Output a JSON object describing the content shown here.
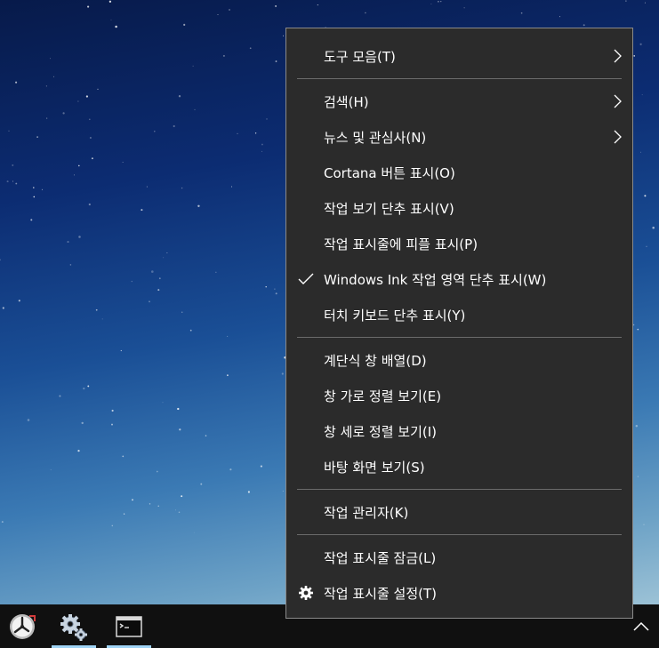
{
  "menu": {
    "items": [
      {
        "label": "도구 모음(T)",
        "submenu": true
      },
      {
        "label": "검색(H)",
        "submenu": true
      },
      {
        "label": "뉴스 및 관심사(N)",
        "submenu": true
      },
      {
        "label": "Cortana 버튼 표시(O)"
      },
      {
        "label": "작업 보기 단추 표시(V)"
      },
      {
        "label": "작업 표시줄에 피플 표시(P)"
      },
      {
        "label": "Windows Ink 작업 영역 단추 표시(W)",
        "checked": true
      },
      {
        "label": "터치 키보드 단추 표시(Y)"
      },
      {
        "label": "계단식 창 배열(D)"
      },
      {
        "label": "창 가로 정렬 보기(E)"
      },
      {
        "label": "창 세로 정렬 보기(I)"
      },
      {
        "label": "바탕 화면 보기(S)"
      },
      {
        "label": "작업 관리자(K)"
      },
      {
        "label": "작업 표시줄 잠금(L)"
      },
      {
        "label": "작업 표시줄 설정(T)",
        "icon": "gear-icon"
      }
    ]
  },
  "taskbar": {
    "apps": [
      {
        "icon": "clock-app-icon",
        "active": false
      },
      {
        "icon": "settings-gears-icon",
        "active": true
      },
      {
        "icon": "terminal-icon",
        "active": true
      }
    ],
    "tray": {
      "icon": "chevron-up-icon"
    }
  },
  "colors": {
    "menu_bg": "#2b2b2b",
    "menu_border": "#8a8a8a",
    "separator": "#6b6b6b",
    "taskbar_bg": "#101010",
    "active_indicator": "#9fd3f5"
  }
}
